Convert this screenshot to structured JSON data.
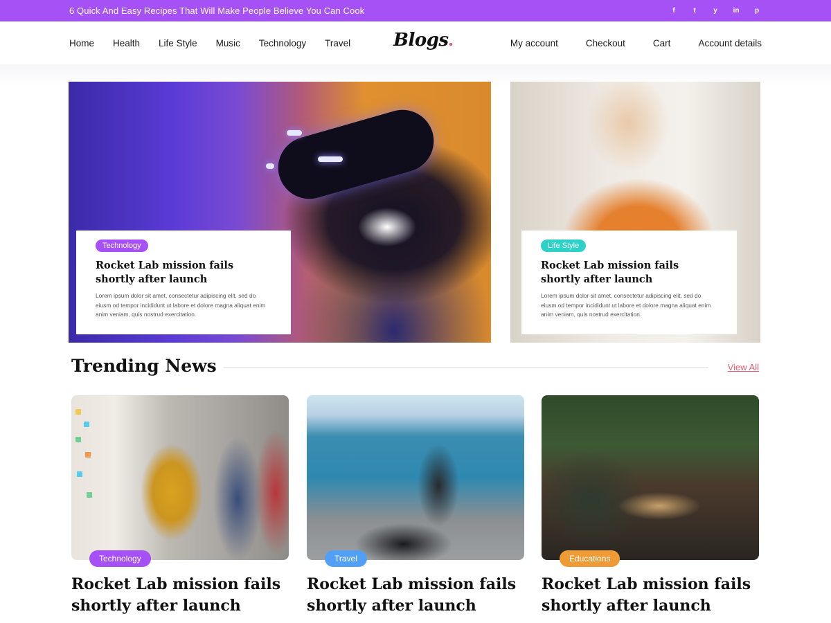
{
  "topbar": {
    "promo": "6 Quick And Easy Recipes That Will Make People Believe You Can Cook",
    "social": [
      "f",
      "t",
      "y",
      "in",
      "p"
    ]
  },
  "nav": {
    "left": [
      "Home",
      "Health",
      "Life Style",
      "Music",
      "Technology",
      "Travel"
    ],
    "logo": "Blogs",
    "right": [
      "My account",
      "Checkout",
      "Cart",
      "Account details"
    ]
  },
  "hero": [
    {
      "category": "Technology",
      "title": "Rocket Lab mission fails shortly after launch",
      "desc": "Lorem ipsum dolor sit amet, consectetur adipiscing elit, sed do eiusm od tempor incididunt ut labore et dolore magna aliquat enim anim veniam, quis nostrud exercitation."
    },
    {
      "category": "Life Style",
      "title": "Rocket Lab mission fails shortly after launch",
      "desc": "Lorem ipsum dolor sit amet, consectetur adipiscing elit, sed do eiusm od tempor incididunt ut labore et dolore magna aliquat enim anim veniam, quis nostrud exercitation."
    }
  ],
  "trending": {
    "heading": "Trending News",
    "view_all": "View All",
    "cards": [
      {
        "category": "Technology",
        "title": "Rocket Lab mission fails shortly after launch"
      },
      {
        "category": "Travel",
        "title": "Rocket Lab mission fails shortly after launch"
      },
      {
        "category": "Educations",
        "title": "Rocket Lab mission fails shortly after launch"
      }
    ]
  },
  "colors": {
    "accent": "#a651f5",
    "teal": "#2ed1c8",
    "blue": "#52a0f5",
    "orange": "#ef9b35",
    "link": "#ea5d6e"
  }
}
